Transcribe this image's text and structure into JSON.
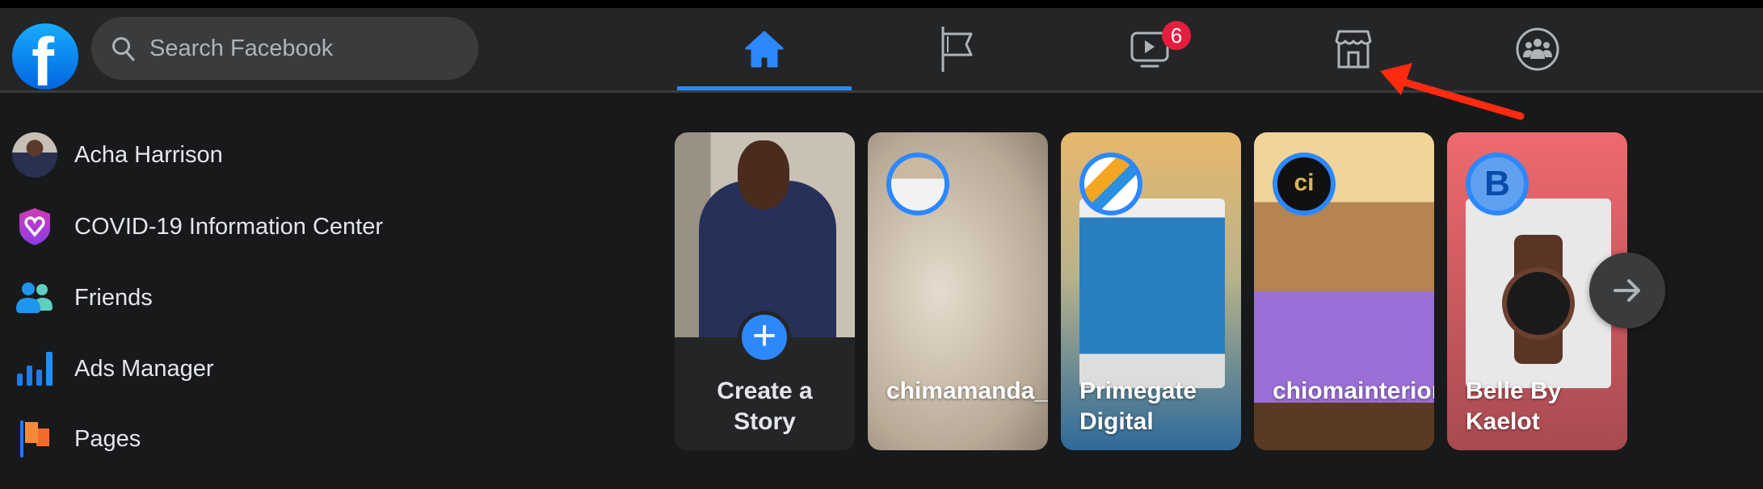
{
  "header": {
    "search": {
      "placeholder": "Search Facebook"
    },
    "nav": [
      {
        "name": "home",
        "active": true
      },
      {
        "name": "pages"
      },
      {
        "name": "watch",
        "badge": "6"
      },
      {
        "name": "marketplace"
      },
      {
        "name": "groups"
      }
    ]
  },
  "sidebar": {
    "items": [
      {
        "label": "Acha Harrison",
        "icon": "avatar"
      },
      {
        "label": "COVID-19 Information Center",
        "icon": "covid-shield-icon"
      },
      {
        "label": "Friends",
        "icon": "friends-icon"
      },
      {
        "label": "Ads Manager",
        "icon": "ads-manager-icon"
      },
      {
        "label": "Pages",
        "icon": "pages-flag-icon"
      }
    ]
  },
  "stories": {
    "create": {
      "line1": "Create a",
      "line2": "Story"
    },
    "items": [
      {
        "name": "chimamanda_interior"
      },
      {
        "name": "Primegate Digital"
      },
      {
        "name": "chiomainterior"
      },
      {
        "name": "Belle By Kaelot",
        "avatar_letter": "B"
      }
    ]
  },
  "colors": {
    "accent": "#2d88ff",
    "badge": "#e41e3f",
    "annotation_arrow": "#ff2a10"
  }
}
